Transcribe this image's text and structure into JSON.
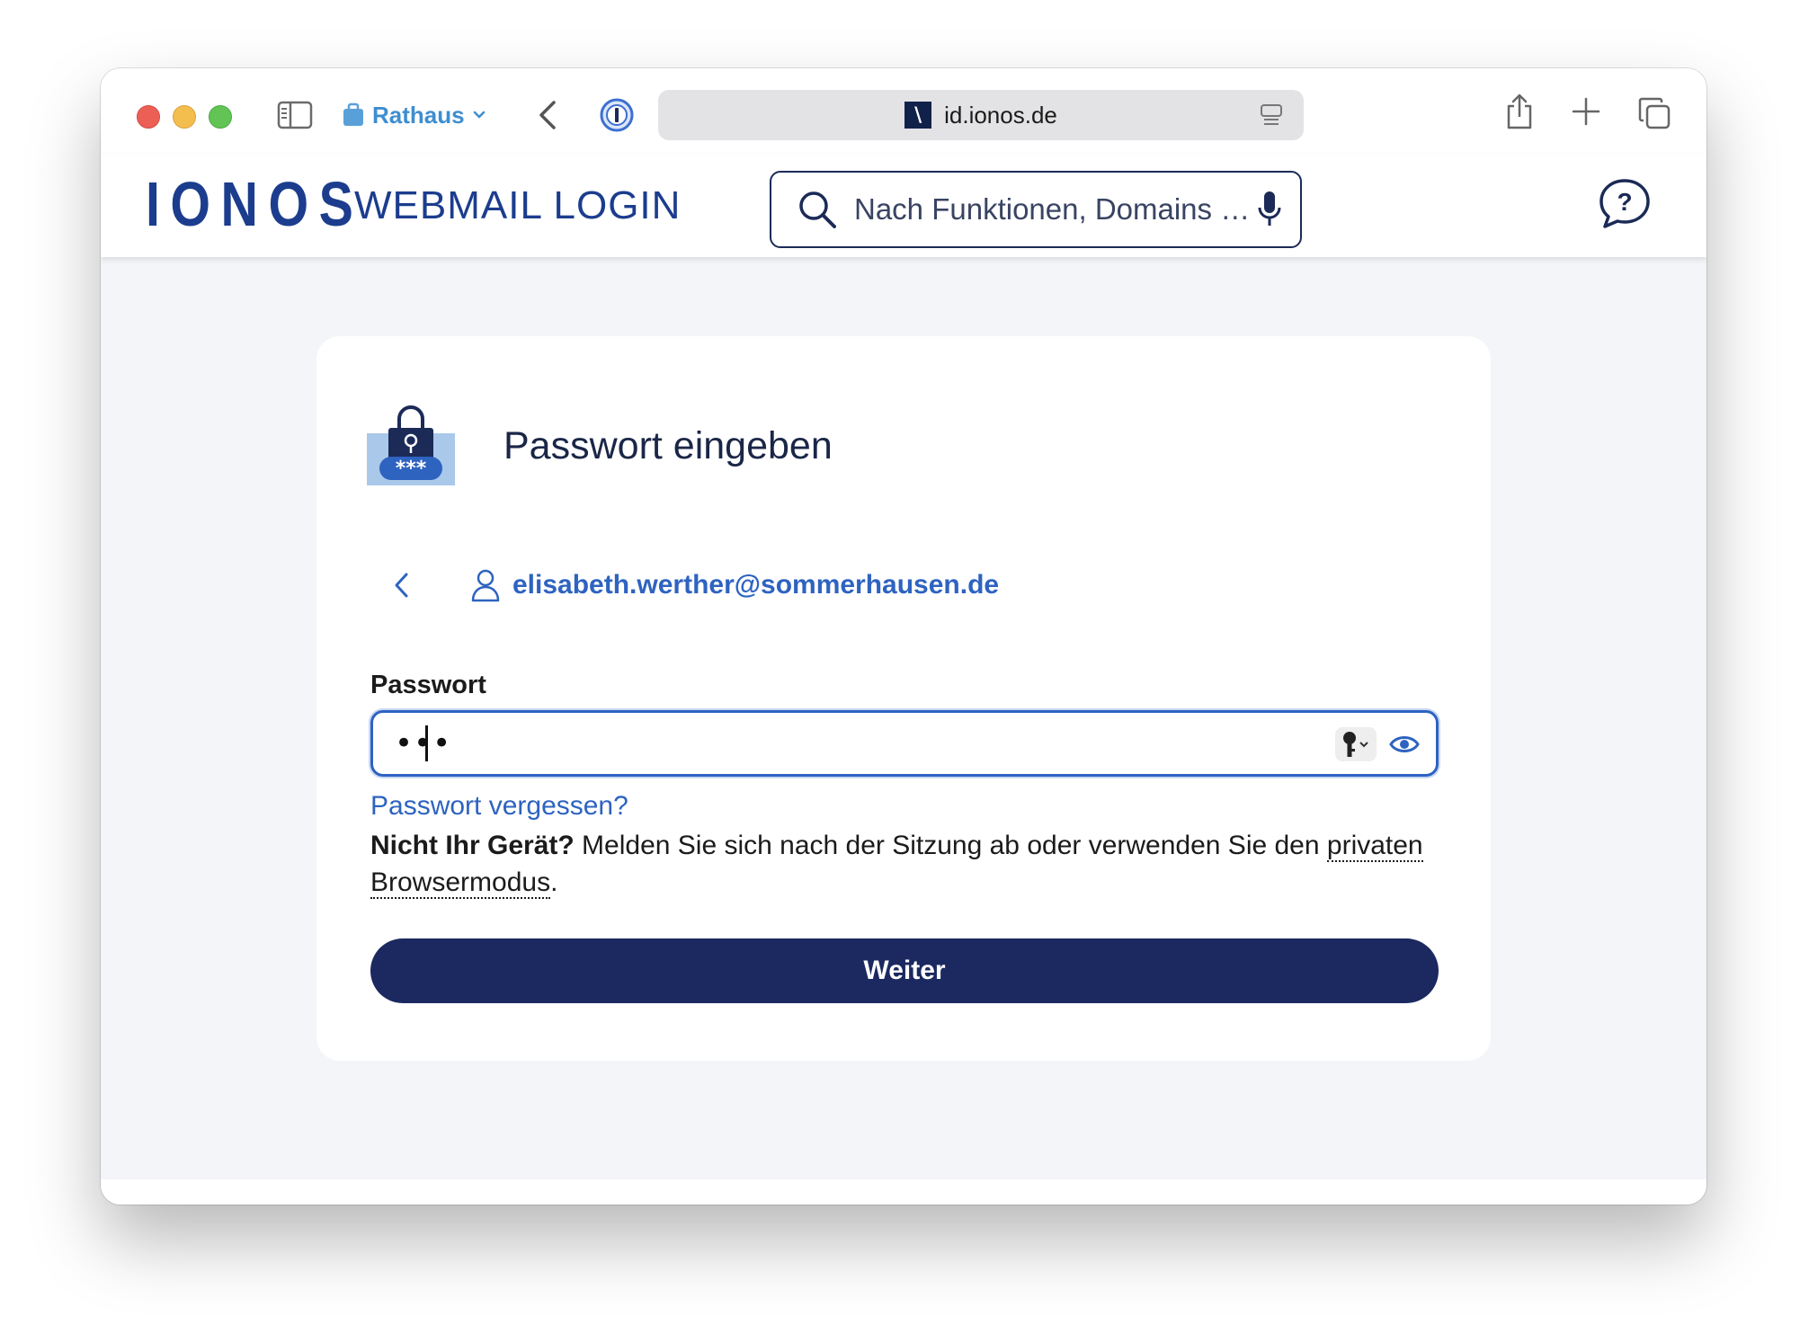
{
  "browser": {
    "tab_group_label": "Rathaus",
    "url": "id.ionos.de",
    "favicon_glyph": "\\",
    "colors": {
      "tab_group": "#3e8ed0",
      "address_bg": "#e3e3e5"
    }
  },
  "header": {
    "logo": "IONOS",
    "title": "WEBMAIL LOGIN",
    "search_placeholder": "Nach Funktionen, Domains …",
    "colors": {
      "brand": "#1c3d8e",
      "search_border": "#1b2a57"
    }
  },
  "card": {
    "title": "Passwort eingeben",
    "lock_stars": "***",
    "email": "elisabeth.werther@sommerhausen.de",
    "password_label": "Passwort",
    "password_value": "•••",
    "forgot_link": "Passwort vergessen?",
    "notice_strong": "Nicht Ihr Gerät?",
    "notice_text": " Melden Sie sich nach der Sitzung ab oder verwenden Sie den ",
    "notice_link": "privaten Browsermodus",
    "notice_end": ".",
    "submit_label": "Weiter",
    "colors": {
      "primary_button": "#1b2960",
      "link": "#2e63c0",
      "focus_border": "#2d62c2"
    }
  }
}
